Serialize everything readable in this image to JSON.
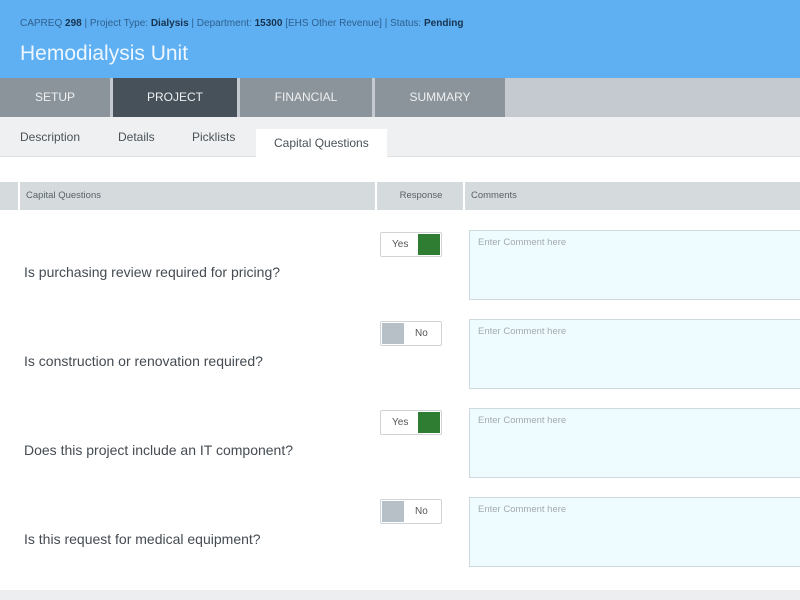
{
  "header": {
    "capreq_label": "CAPREQ",
    "capreq": "298",
    "type_label": "Project Type:",
    "type": "Dialysis",
    "dept_label": "Department:",
    "dept": "15300",
    "dept_name": "[EHS Other Revenue]",
    "status_label": "Status:",
    "status": "Pending",
    "title": "Hemodialysis Unit"
  },
  "nav": [
    {
      "label": "SETUP"
    },
    {
      "label": "PROJECT"
    },
    {
      "label": "FINANCIAL"
    },
    {
      "label": "SUMMARY"
    }
  ],
  "subtabs": [
    {
      "label": "Description"
    },
    {
      "label": "Details"
    },
    {
      "label": "Picklists"
    },
    {
      "label": "Capital Questions"
    }
  ],
  "table": {
    "headers": {
      "question": "Capital Questions",
      "response": "Response",
      "comments": "Comments"
    },
    "rows": [
      {
        "question": "Is purchasing review required for pricing?",
        "response": "Yes",
        "placeholder": "Enter Comment here"
      },
      {
        "question": "Is construction or renovation required?",
        "response": "No",
        "placeholder": "Enter Comment here"
      },
      {
        "question": "Does this project include an IT component?",
        "response": "Yes",
        "placeholder": "Enter Comment here"
      },
      {
        "question": "Is this request for medical equipment?",
        "response": "No",
        "placeholder": "Enter Comment here"
      }
    ]
  },
  "colors": {
    "header": "#5eb0f2",
    "active_tab": "#465159",
    "toggle_on": "#2e7d32",
    "toggle_off": "#b7c0c6"
  }
}
